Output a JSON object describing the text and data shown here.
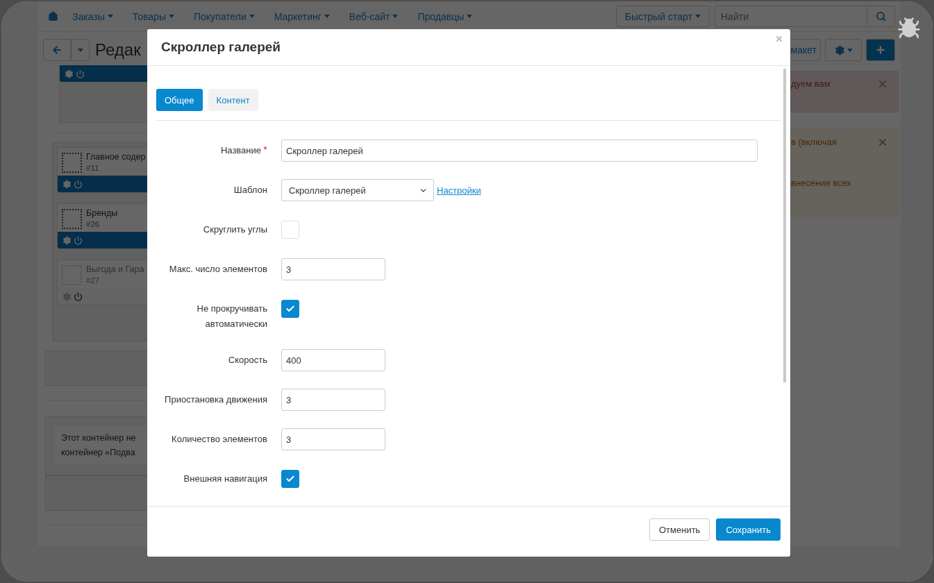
{
  "navbar": {
    "menus": [
      {
        "label": "Заказы"
      },
      {
        "label": "Товары"
      },
      {
        "label": "Покупатели"
      },
      {
        "label": "Маркетинг"
      },
      {
        "label": "Веб-сайт"
      },
      {
        "label": "Продавцы"
      }
    ],
    "quick_start": "Быстрый старт",
    "search": {
      "placeholder": "Найти"
    }
  },
  "toolbar": {
    "title": "Редак",
    "layout_button": "макет"
  },
  "layout": {
    "blocks": [
      {
        "name": "Главное содер",
        "number": "#11",
        "disabled": false
      },
      {
        "name": "Бренды",
        "number": "#26",
        "disabled": false
      },
      {
        "name": "Выгода и Гара",
        "number": "#27",
        "disabled": true
      }
    ],
    "notice": [
      "Этот контейнер не",
      "контейнер «Подва"
    ]
  },
  "alerts": [
    {
      "kind": "danger",
      "lines": [
        "дуем вам"
      ]
    },
    {
      "kind": "warning",
      "lines": [
        "в (включая",
        "внесения всех"
      ]
    }
  ],
  "dialog": {
    "title": "Скроллер галерей",
    "tabs": [
      {
        "label": "Общее",
        "selected": true
      },
      {
        "label": "Контент",
        "selected": false
      }
    ],
    "fields": [
      {
        "kind": "text",
        "label": "Название",
        "required": true,
        "value": "Скроллер галерей"
      },
      {
        "kind": "select",
        "label": "Шаблон",
        "value": "Скроллер галерей",
        "link": "Настройки"
      },
      {
        "kind": "checkbox",
        "label": "Скруглить углы",
        "checked": false
      },
      {
        "kind": "text",
        "label": "Макс. число элементов",
        "value": "3"
      },
      {
        "kind": "checkbox",
        "label": "Не прокручивать автоматически",
        "checked": true
      },
      {
        "kind": "text",
        "label": "Скорость",
        "value": "400"
      },
      {
        "kind": "text",
        "label": "Приостановка движения",
        "value": "3"
      },
      {
        "kind": "text",
        "label": "Количество элементов",
        "value": "3"
      },
      {
        "kind": "checkbox",
        "label": "Внешняя навигация",
        "checked": true
      }
    ],
    "buttons": [
      {
        "label": "Отменить",
        "kind": "default"
      },
      {
        "label": "Сохранить",
        "kind": "primary"
      }
    ]
  }
}
